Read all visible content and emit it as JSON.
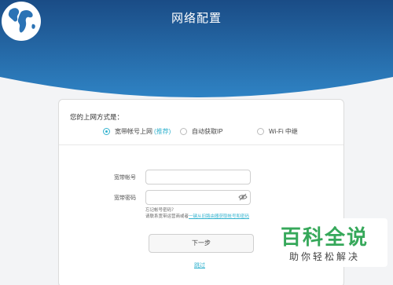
{
  "header": {
    "title": "网络配置",
    "icon": "globe-icon",
    "colors": {
      "top": "#1b4f8a",
      "bottom": "#2e7ec0"
    }
  },
  "card": {
    "mode_title": "您的上网方式是：",
    "options": [
      {
        "label": "宽带帐号上网",
        "suffix": "(推荐)",
        "selected": true
      },
      {
        "label": "自动获取IP",
        "selected": false
      },
      {
        "label": "Wi-Fi 中继",
        "selected": false
      }
    ],
    "account": {
      "label": "宽带帐号",
      "value": "",
      "placeholder": ""
    },
    "password": {
      "label": "宽带密码",
      "value": "",
      "placeholder": "",
      "toggle_icon": "eye-off-icon"
    },
    "hint_line1": "忘记帐号密码？",
    "hint_line2_prefix": "请联系宽带运营商或者",
    "hint_link": "一键从旧路由器获取帐号和密码",
    "next_button": "下一步",
    "skip_link": "跳过"
  },
  "watermark": {
    "main": "百科全说",
    "sub": "助你轻松解决"
  },
  "accent_color": "#34b3cf"
}
